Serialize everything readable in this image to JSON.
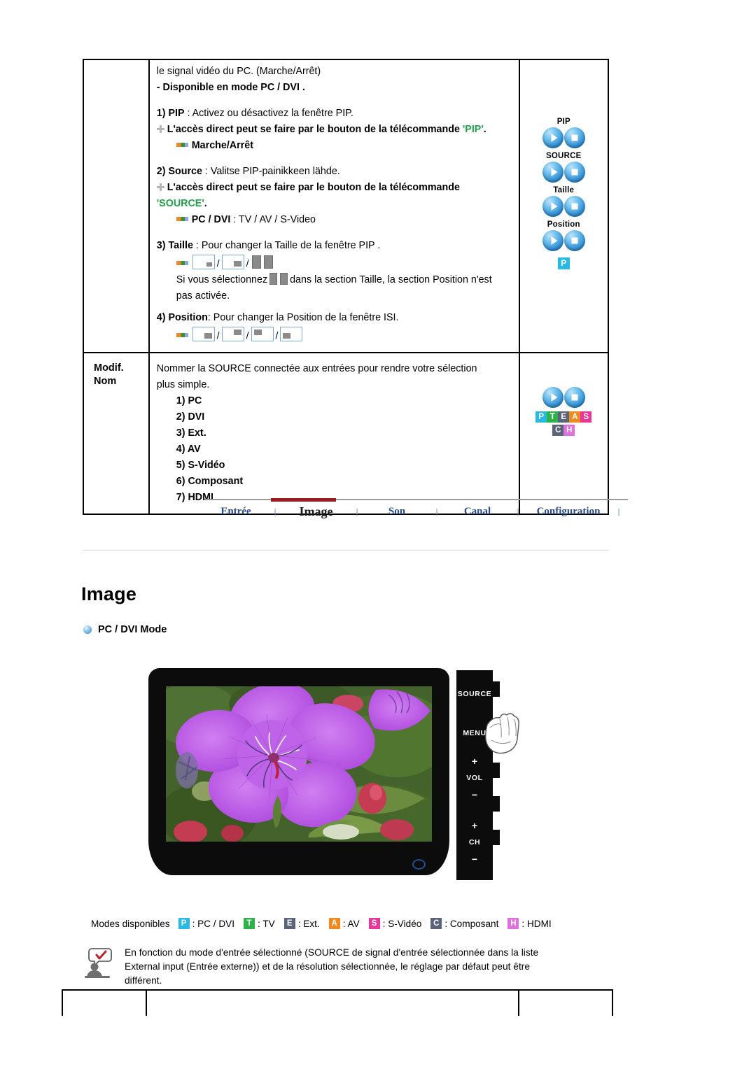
{
  "table": {
    "row1": {
      "label": "",
      "lines": {
        "intro": "le signal vidéo du PC. (Marche/Arrêt)",
        "available": "- Disponible en mode PC / DVI .",
        "item1_num": "1) ",
        "item1_bold": "PIP",
        "item1_rest": " : Activez ou désactivez la fenêtre PIP.",
        "item1_access_a": "L'accès direct peut se faire par le bouton de la télécommande ",
        "item1_access_key": "'PIP'",
        "item1_access_b": ".",
        "item1_sub": "Marche/Arrêt",
        "item2_num": "2) ",
        "item2_bold": "Source",
        "item2_rest": " : Valitse PIP-painikkeen lähde.",
        "item2_access_a": "L'accès direct peut se faire par le bouton de la télécommande",
        "item2_access_key": "'SOURCE'",
        "item2_access_b": ".",
        "item2_sub_bold": "PC / DVI",
        "item2_sub_rest": " : TV / AV / S-Video",
        "item3_num": "3) ",
        "item3_bold": "Taille",
        "item3_rest": " : Pour changer la Taille de la fenêtre PIP .",
        "item3_note_a": "Si vous sélectionnez",
        "item3_note_b": "dans la section Taille, la section Position n'est",
        "item3_note_c": "pas activée.",
        "item4_num": "4) ",
        "item4_bold": "Position",
        "item4_rest": ": Pour changer la Position de la fenêtre ISI."
      },
      "remote": {
        "groups": [
          {
            "label": "PIP"
          },
          {
            "label": "SOURCE"
          },
          {
            "label": "Taille"
          },
          {
            "label": "Position"
          }
        ],
        "badge": "P"
      }
    },
    "row2": {
      "label_line1": "Modif.",
      "label_line2": "Nom",
      "intro_line1": "Nommer la SOURCE connectée aux entrées pour rendre votre sélection",
      "intro_line2": "plus simple.",
      "items": [
        "1) PC",
        "2) DVI",
        "3) Ext.",
        "4) AV",
        "5) S-Vidéo",
        "6) Composant",
        "7) HDMI"
      ],
      "badges_row1": [
        {
          "letter": "P",
          "color": "#28b9e4"
        },
        {
          "letter": "T",
          "color": "#2fb24a"
        },
        {
          "letter": "E",
          "color": "#5a6378"
        },
        {
          "letter": "A",
          "color": "#f08a1e"
        },
        {
          "letter": "S",
          "color": "#e8369a"
        }
      ],
      "badges_row2": [
        {
          "letter": "C",
          "color": "#5a6378"
        },
        {
          "letter": "H",
          "color": "#e070e0"
        }
      ]
    }
  },
  "nav": {
    "tabs": [
      {
        "label": "Entrée",
        "active": false
      },
      {
        "label": "Image",
        "active": true
      },
      {
        "label": "Son",
        "active": false
      },
      {
        "label": "Canal",
        "active": false
      },
      {
        "label": "Configuration",
        "active": false
      }
    ],
    "separator": "|",
    "active_bar_color": "#9d1a20",
    "link_color": "#2b4a86"
  },
  "page": {
    "title": "Image",
    "subhead": "PC / DVI Mode"
  },
  "monitor": {
    "side_buttons": [
      {
        "text": "SOURCE",
        "type": "text"
      },
      {
        "text": "MENU",
        "type": "text"
      },
      {
        "text": "+",
        "type": "sym"
      },
      {
        "text": "VOL",
        "type": "text"
      },
      {
        "text": "−",
        "type": "sym"
      },
      {
        "text": "+",
        "type": "sym"
      },
      {
        "text": "CH",
        "type": "text"
      },
      {
        "text": "−",
        "type": "sym"
      }
    ]
  },
  "modes": {
    "label": "Modes disponibles",
    "items": [
      {
        "letter": "P",
        "color": "#28b9e4",
        "text": ": PC / DVI"
      },
      {
        "letter": "T",
        "color": "#2fb24a",
        "text": ": TV"
      },
      {
        "letter": "E",
        "color": "#5a6378",
        "text": ": Ext."
      },
      {
        "letter": "A",
        "color": "#f08a1e",
        "text": ": AV"
      },
      {
        "letter": "S",
        "color": "#e8369a",
        "text": ": S-Vidéo"
      },
      {
        "letter": "C",
        "color": "#5a6378",
        "text": ": Composant"
      },
      {
        "letter": "H",
        "color": "#e070e0",
        "text": ": HDMI"
      }
    ]
  },
  "note": {
    "line1": "En fonction du mode d'entrée sélectionné (SOURCE de signal d'entrée sélectionnée dans la liste",
    "line2": "External input (Entrée externe)) et de la résolution sélectionnée, le réglage par défaut peut être",
    "line3": "différent."
  }
}
